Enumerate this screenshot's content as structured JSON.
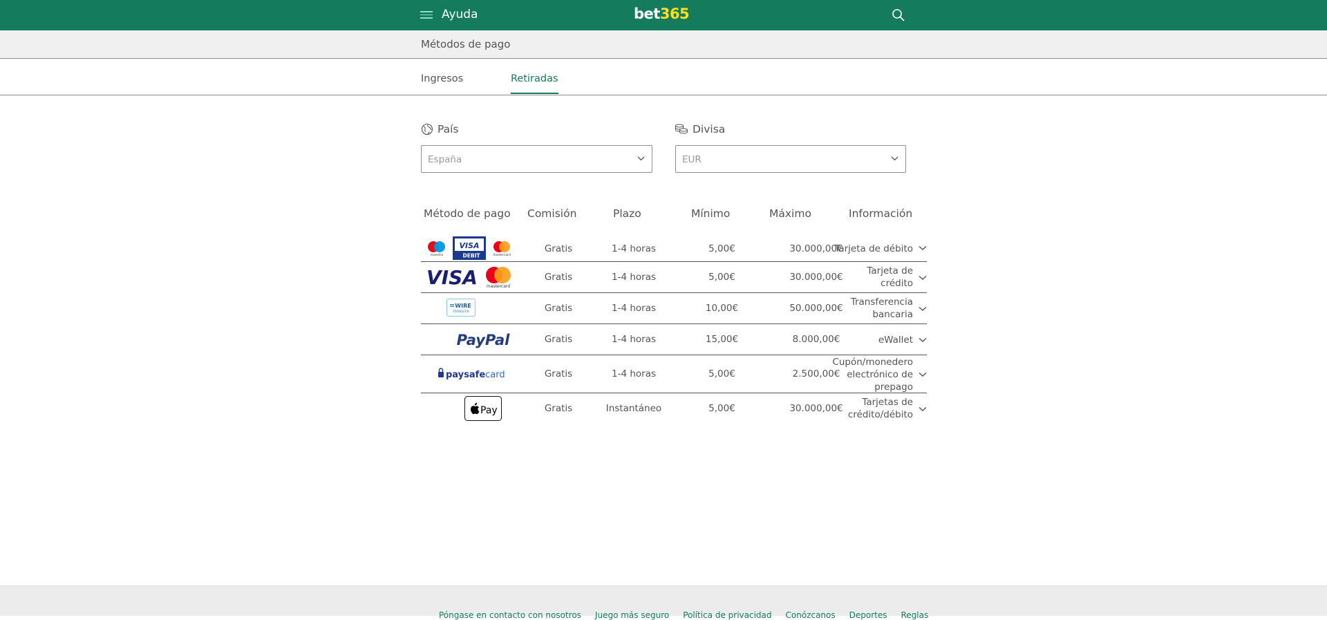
{
  "header": {
    "section_title": "Ayuda",
    "logo_main": "bet",
    "logo_accent": "365",
    "menu_icon": "hamburger-icon",
    "search_icon": "search-icon"
  },
  "breadcrumb": {
    "title": "Métodos de pago"
  },
  "tabs": [
    {
      "label": "Ingresos",
      "active": false
    },
    {
      "label": "Retiradas",
      "active": true
    }
  ],
  "filters": {
    "country": {
      "label": "País",
      "value": "España",
      "icon": "globe-icon"
    },
    "currency": {
      "label": "Divisa",
      "value": "EUR",
      "icon": "coins-icon"
    }
  },
  "table": {
    "headers": {
      "method": "Método de pago",
      "fee": "Comisión",
      "time": "Plazo",
      "min": "Mínimo",
      "max": "Máximo",
      "info": "Información"
    },
    "rows": [
      {
        "logos": [
          "maestro-logo",
          "visa-debit-logo",
          "mastercard-logo"
        ],
        "fee": "Gratis",
        "time": "1-4 horas",
        "min": "5,00€",
        "max": "30.000,00€",
        "info": "Tarjeta de débito"
      },
      {
        "logos": [
          "visa-logo",
          "mastercard-logo"
        ],
        "fee": "Gratis",
        "time": "1-4 horas",
        "min": "5,00€",
        "max": "30.000,00€",
        "info": "Tarjeta de crédito"
      },
      {
        "logos": [
          "wire-transfer-logo"
        ],
        "fee": "Gratis",
        "time": "1-4 horas",
        "min": "10,00€",
        "max": "50.000,00€",
        "info": "Transferencia bancaria"
      },
      {
        "logos": [
          "paypal-logo"
        ],
        "fee": "Gratis",
        "time": "1-4 horas",
        "min": "15,00€",
        "max": "8.000,00€",
        "info": "eWallet"
      },
      {
        "logos": [
          "paysafecard-logo"
        ],
        "fee": "Gratis",
        "time": "1-4 horas",
        "min": "5,00€",
        "max": "2.500,00€",
        "info": "Cupón/monedero electrónico de prepago"
      },
      {
        "logos": [
          "apple-pay-logo"
        ],
        "fee": "Gratis",
        "time": "Instantáneo",
        "min": "5,00€",
        "max": "30.000,00€",
        "info": "Tarjetas de crédito/débito"
      }
    ],
    "logo_text": {
      "maestro": "maestro",
      "visa_debit_top": "VISA",
      "visa_debit_bottom": "DEBIT",
      "mastercard": "mastercard",
      "visa": "VISA",
      "wire_top": "WIRE",
      "wire_bottom": "TRANSFER",
      "paypal": "PayPal",
      "paysafe_bold": "paysafe",
      "paysafe_light": "card",
      "applepay": "Pay"
    }
  },
  "footer": {
    "links": [
      "Póngase en contacto con nosotros",
      "Juego más seguro",
      "Política de privacidad",
      "Conózcanos",
      "Deportes",
      "Reglas"
    ]
  },
  "colors": {
    "brand": "#147b5d",
    "logo_accent": "#ffdf1b",
    "text": "#545454"
  }
}
